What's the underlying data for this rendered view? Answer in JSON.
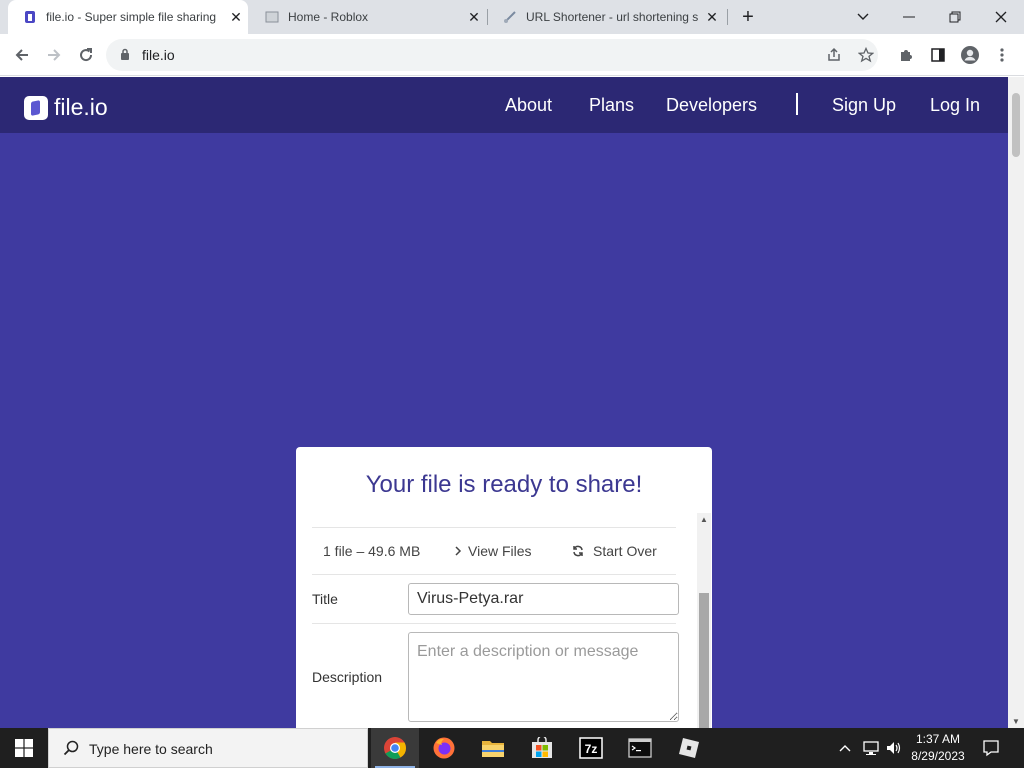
{
  "browser": {
    "tabs": [
      {
        "title": "file.io - Super simple file sharing",
        "active": true
      },
      {
        "title": "Home - Roblox",
        "active": false
      },
      {
        "title": "URL Shortener - url shortening s",
        "active": false
      }
    ],
    "new_tab_label": "+",
    "url": "file.io"
  },
  "site": {
    "brand": "file.io",
    "nav": {
      "about": "About",
      "plans": "Plans",
      "developers": "Developers",
      "signup": "Sign Up",
      "login": "Log In"
    },
    "card": {
      "heading": "Your file is ready to share!",
      "file_summary": "1 file – 49.6 MB",
      "view_files": "View Files",
      "start_over": "Start Over",
      "title_label": "Title",
      "title_value": "Virus-Petya.rar",
      "description_label": "Description",
      "description_placeholder": "Enter a description or message"
    }
  },
  "taskbar": {
    "search_placeholder": "Type here to search",
    "time": "1:37 AM",
    "date": "8/29/2023",
    "apps": [
      "chrome",
      "firefox",
      "file-explorer",
      "microsoft-store",
      "7-zip",
      "terminal",
      "roblox"
    ]
  },
  "colors": {
    "nav_bg": "#2c2874",
    "page_bg": "#3f3aa0",
    "heading": "#3c3891"
  }
}
